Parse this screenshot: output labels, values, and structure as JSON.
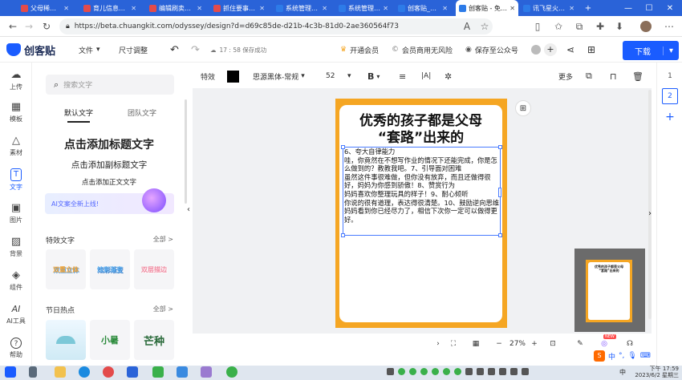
{
  "browser": {
    "tabs": [
      {
        "label": "父母稀…",
        "color": "#e34b4b"
      },
      {
        "label": "育儿信息…",
        "color": "#e34b4b"
      },
      {
        "label": "编辑刷卖…",
        "color": "#e34b4b"
      },
      {
        "label": "抓住要事…",
        "color": "#e34b4b"
      },
      {
        "label": "系统管理…",
        "color": "#2d7be8"
      },
      {
        "label": "系统管理…",
        "color": "#2d7be8"
      },
      {
        "label": "创客贴_…",
        "color": "#2d7be8"
      },
      {
        "label": "创客贴 - 免…",
        "color": "#2d7be8"
      },
      {
        "label": "讯飞星火…",
        "color": "#2d7be8"
      }
    ],
    "url": "https://beta.chuangkit.com/odyssey/design?d=d69c85de-d21b-4c3b-81d0-2ae360564f73",
    "new_tab": "+",
    "minimize": "—",
    "maximize": "☐",
    "close": "✕"
  },
  "header": {
    "logo_text": "创客贴",
    "file_menu": "文件",
    "resize": "尺寸调整",
    "save_status": "17 : 58 保存成功",
    "vip": "开通会员",
    "commercial": "会员商用无风险",
    "save_to_account": "保存至公众号",
    "download": "下载"
  },
  "rail": {
    "items": [
      {
        "label": "上传",
        "icon": "☁"
      },
      {
        "label": "模板",
        "icon": "▦"
      },
      {
        "label": "素材",
        "icon": "△"
      },
      {
        "label": "文字",
        "icon": "T"
      },
      {
        "label": "图片",
        "icon": "▣"
      },
      {
        "label": "背景",
        "icon": "▨"
      },
      {
        "label": "组件",
        "icon": "◈"
      },
      {
        "label": "AI工具",
        "icon": "AI"
      },
      {
        "label": "帮助",
        "icon": "?"
      }
    ]
  },
  "panel": {
    "search_placeholder": "搜索文字",
    "tab_default": "默认文字",
    "tab_team": "团队文字",
    "add_title": "点击添加标题文字",
    "add_subtitle": "点击添加副标题文字",
    "add_body": "点击添加正文文字",
    "ai_banner": "AI文案全新上线!",
    "effects_title": "特效文字",
    "effects_more": "全部 >",
    "effects_samples": [
      "双重立体",
      "炫彩渐变",
      "双层描边"
    ],
    "holiday_title": "节日热点",
    "holiday_more": "全部 >",
    "holiday_samples": [
      "",
      "小暑",
      "芒种"
    ]
  },
  "toolbar": {
    "effects": "特效",
    "color": "#000000",
    "font": "思源黑体-常规",
    "size": "52",
    "bold": "B",
    "more": "更多"
  },
  "poster": {
    "title_line1": "优秀的孩子都是父母",
    "title_line2": "“套路”出来的",
    "body": "6、夸大自律能力\n哇，你竟然在不想写作业的情况下还能完成，你是怎么做到的？教教我吧。7、引导面对困难\n虽然这件事很难做，但你没有放弃，而且还做得很好，妈妈为你感到骄傲！8、赞赏行为\n妈妈喜欢你整理玩具的样子！9、耐心倾听\n你说的很有道理，表达得很清楚。10、鼓励逆向思维\n妈妈看到你已经尽力了，相信下次你一定可以做得更好。",
    "colors": {
      "frame": "#f5a623",
      "inner": "#ffffff"
    }
  },
  "minimap": {
    "title": "优秀的孩子都是父母\n“套路”出来的"
  },
  "pages": [
    "1",
    "2",
    "+"
  ],
  "zoom": {
    "value": "27%",
    "minus": "−",
    "plus": "+",
    "new_badge": "NEW"
  },
  "taskbar": {
    "time": "下午 17:59",
    "date": "2023/6/2 星期三",
    "ime": "中"
  }
}
